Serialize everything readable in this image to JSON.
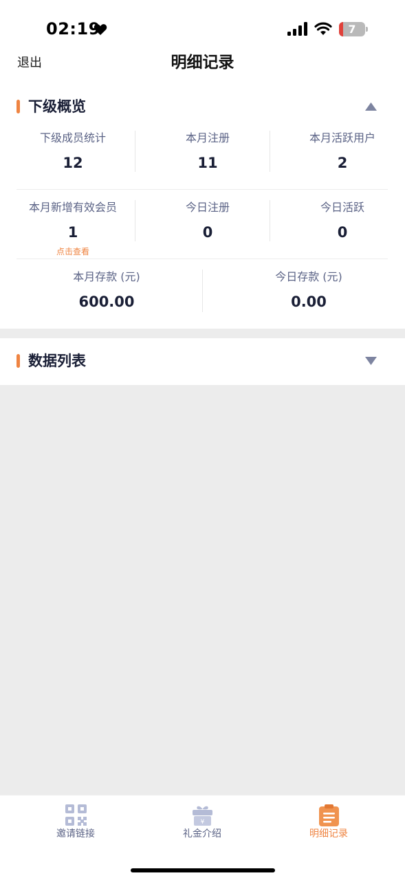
{
  "status_bar": {
    "time": "02:19",
    "battery": "7"
  },
  "header": {
    "back_label": "退出",
    "title": "明细记录"
  },
  "overview": {
    "title": "下级概览",
    "rows": [
      [
        {
          "label": "下级成员统计",
          "value": "12"
        },
        {
          "label": "本月注册",
          "value": "11"
        },
        {
          "label": "本月活跃用户",
          "value": "2"
        }
      ],
      [
        {
          "label": "本月新增有效会员",
          "value": "1",
          "link": "点击查看"
        },
        {
          "label": "今日注册",
          "value": "0"
        },
        {
          "label": "今日活跃",
          "value": "0"
        }
      ],
      [
        {
          "label": "本月存款 (元)",
          "value": "600.00"
        },
        {
          "label": "今日存款 (元)",
          "value": "0.00"
        }
      ]
    ]
  },
  "data_list": {
    "title": "数据列表"
  },
  "tabs": [
    {
      "label": "邀请链接",
      "icon": "qr-code-icon",
      "active": false
    },
    {
      "label": "礼金介绍",
      "icon": "gift-icon",
      "active": false
    },
    {
      "label": "明细记录",
      "icon": "clipboard-icon",
      "active": true
    }
  ],
  "colors": {
    "accent": "#ef8442",
    "text_primary": "#1a1f36",
    "text_secondary": "#5a6285",
    "background": "#ececec"
  }
}
